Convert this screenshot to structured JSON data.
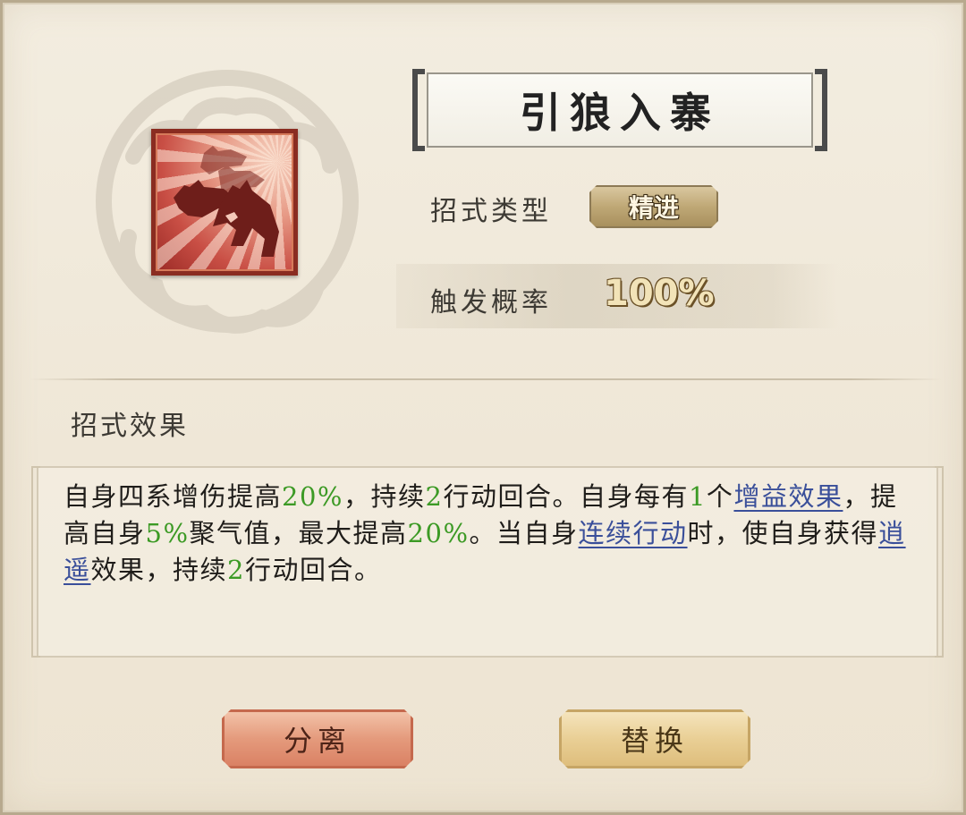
{
  "skill": {
    "name": "引狼入寨",
    "type_label": "招式类型",
    "type_value": "精进",
    "prob_label": "触发概率",
    "prob_value": "100%",
    "icon": "wolves-icon"
  },
  "effect": {
    "heading": "招式效果",
    "segments": [
      {
        "t": "自身四系增伤提高",
        "s": "n"
      },
      {
        "t": "20%",
        "s": "g"
      },
      {
        "t": "，持续",
        "s": "n"
      },
      {
        "t": "2",
        "s": "g"
      },
      {
        "t": "行动回合。自身每有",
        "s": "n"
      },
      {
        "t": "1",
        "s": "g"
      },
      {
        "t": "个",
        "s": "n"
      },
      {
        "t": "增益效果",
        "s": "k"
      },
      {
        "t": "，提高自身",
        "s": "n"
      },
      {
        "t": "5%",
        "s": "g"
      },
      {
        "t": "聚气值，最大提高",
        "s": "n"
      },
      {
        "t": "20%",
        "s": "g"
      },
      {
        "t": "。当自身",
        "s": "n"
      },
      {
        "t": "连续行动",
        "s": "k"
      },
      {
        "t": "时，使自身获得",
        "s": "n"
      },
      {
        "t": "逍遥",
        "s": "k"
      },
      {
        "t": "效果，持续",
        "s": "n"
      },
      {
        "t": "2",
        "s": "g"
      },
      {
        "t": "行动回合。",
        "s": "n"
      }
    ]
  },
  "buttons": {
    "split": "分离",
    "replace": "替换"
  },
  "colors": {
    "highlight_green": "#3c9a25",
    "keyword_blue": "#3a4f9a"
  }
}
